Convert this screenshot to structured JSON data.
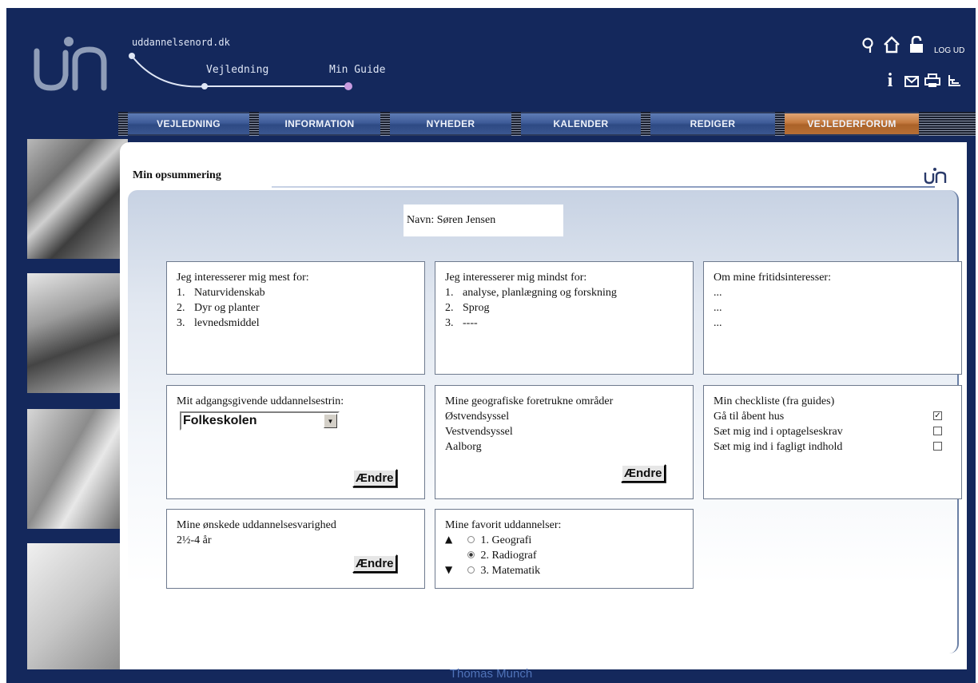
{
  "header": {
    "site_name": "uddannelsenord.dk",
    "crumbs": [
      "Vejledning",
      "Min Guide"
    ],
    "logout_label": "LOG UD",
    "icons": [
      "search-icon",
      "home-icon",
      "lock-icon",
      "info-icon",
      "mail-icon",
      "print-icon",
      "sitemap-icon"
    ]
  },
  "nav": {
    "tabs": [
      {
        "label": "VEJLEDNING"
      },
      {
        "label": "INFORMATION"
      },
      {
        "label": "NYHEDER"
      },
      {
        "label": "KALENDER"
      },
      {
        "label": "REDIGER"
      },
      {
        "label": "VEJLEDERFORUM"
      }
    ],
    "active_index": 5
  },
  "content": {
    "heading": "Min opsummering",
    "name_line": "Navn: Søren Jensen",
    "interests_most": {
      "title": "Jeg interesserer mig mest for:",
      "items": [
        {
          "num": "1.",
          "text": "Naturvidenskab"
        },
        {
          "num": "2.",
          "text": "Dyr og planter"
        },
        {
          "num": "3.",
          "text": "levnedsmiddel"
        }
      ]
    },
    "interests_least": {
      "title": "Jeg interesserer mig mindst for:",
      "items": [
        {
          "num": "1.",
          "text": "analyse, planlægning og forskning"
        },
        {
          "num": "2.",
          "text": "Sprog"
        },
        {
          "num": "3.",
          "text": "----"
        }
      ]
    },
    "hobbies": {
      "title": "Om mine fritidsinteresser:",
      "lines": [
        "...",
        "...",
        "..."
      ]
    },
    "education_level": {
      "title": "Mit adgangsgivende uddannelsestrin:",
      "selected": "Folkeskolen",
      "button": "Ændre"
    },
    "regions": {
      "title": "Mine geografiske foretrukne områder",
      "items": [
        "Østvendsyssel",
        "Vestvendsyssel",
        "Aalborg"
      ],
      "button": "Ændre"
    },
    "checklist": {
      "title": "Min checkliste (fra guides)",
      "items": [
        {
          "label": "Gå til åbent hus",
          "checked": true
        },
        {
          "label": "Sæt mig ind i optagelseskrav",
          "checked": false
        },
        {
          "label": "Sæt mig ind i fagligt indhold",
          "checked": false
        }
      ]
    },
    "duration": {
      "title": "Mine ønskede uddannelsesvarighed",
      "value": "2½-4 år",
      "button": "Ændre"
    },
    "favorites": {
      "title": "Mine favorit uddannelser:",
      "items": [
        {
          "label": "1. Geografi",
          "selected": false
        },
        {
          "label": "2. Radiograf",
          "selected": true
        },
        {
          "label": "3. Matematik",
          "selected": false
        }
      ]
    }
  },
  "footer": {
    "text": "Thomas Munch"
  },
  "colors": {
    "background": "#14285c",
    "nav_tab": "#3e5b98",
    "nav_active": "#c47a3f",
    "footer_text": "#4f72b8"
  }
}
